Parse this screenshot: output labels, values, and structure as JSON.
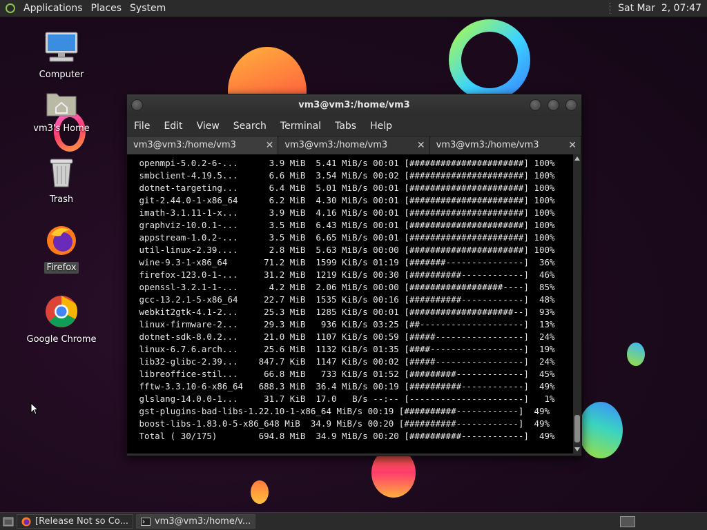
{
  "top_panel": {
    "menus": [
      "Applications",
      "Places",
      "System"
    ],
    "clock": "Sat Mar  2, 07:47"
  },
  "desktop": {
    "icons": [
      {
        "label": "Computer",
        "icon": "computer-icon"
      },
      {
        "label": "vm3's Home",
        "icon": "home-folder-icon"
      },
      {
        "label": "Trash",
        "icon": "trash-icon"
      },
      {
        "label": "Firefox",
        "icon": "firefox-icon",
        "selected": true
      },
      {
        "label": "Google Chrome",
        "icon": "chrome-icon"
      }
    ]
  },
  "terminal": {
    "title": "vm3@vm3:/home/vm3",
    "menu": [
      "File",
      "Edit",
      "View",
      "Search",
      "Terminal",
      "Tabs",
      "Help"
    ],
    "tabs": [
      "vm3@vm3:/home/vm3",
      "vm3@vm3:/home/vm3",
      "vm3@vm3:/home/vm3"
    ],
    "lines": [
      " openmpi-5.0.2-6-...      3.9 MiB  5.41 MiB/s 00:01 [######################] 100%",
      " smbclient-4.19.5...      6.6 MiB  3.54 MiB/s 00:02 [######################] 100%",
      " dotnet-targeting...      6.4 MiB  5.01 MiB/s 00:01 [######################] 100%",
      " git-2.44.0-1-x86_64      6.2 MiB  4.30 MiB/s 00:01 [######################] 100%",
      " imath-3.1.11-1-x...      3.9 MiB  4.16 MiB/s 00:01 [######################] 100%",
      " graphviz-10.0.1-...      3.5 MiB  6.43 MiB/s 00:01 [######################] 100%",
      " appstream-1.0.2-...      3.5 MiB  6.65 MiB/s 00:01 [######################] 100%",
      " util-linux-2.39....      2.8 MiB  5.63 MiB/s 00:00 [######################] 100%",
      " wine-9.3-1-x86_64       71.2 MiB  1599 KiB/s 01:19 [#######---------------]  36%",
      " firefox-123.0-1-...     31.2 MiB  1219 KiB/s 00:30 [##########------------]  46%",
      " openssl-3.2.1-1-...      4.2 MiB  2.06 MiB/s 00:00 [##################----]  85%",
      " gcc-13.2.1-5-x86_64     22.7 MiB  1535 KiB/s 00:16 [##########------------]  48%",
      " webkit2gtk-4.1-2...     25.3 MiB  1285 KiB/s 00:01 [####################--]  93%",
      " linux-firmware-2...     29.3 MiB   936 KiB/s 03:25 [##--------------------]  13%",
      " dotnet-sdk-8.0.2...     21.0 MiB  1107 KiB/s 00:59 [#####-----------------]  24%",
      " linux-6.7.6.arch...     25.6 MiB  1132 KiB/s 01:35 [####------------------]  19%",
      " lib32-glibc-2.39...    847.7 KiB  1147 KiB/s 00:02 [#####-----------------]  24%",
      " libreoffice-stil...     66.8 MiB   733 KiB/s 01:52 [#########-------------]  45%",
      " fftw-3.3.10-6-x86_64   688.3 MiB  36.4 MiB/s 00:19 [##########------------]  49%",
      " glslang-14.0.0-1...     31.7 KiB  17.0   B/s --:-- [----------------------]   1%",
      " gst-plugins-bad-libs-1.22.10-1-x86_64 MiB/s 00:19 [##########------------]  49%",
      " boost-libs-1.83.0-5-x86_648 MiB  34.9 MiB/s 00:20 [##########------------]  49%",
      " Total ( 30/175)        694.8 MiB  34.9 MiB/s 00:20 [##########------------]  49%"
    ]
  },
  "taskbar": {
    "items": [
      {
        "label": "[Release Not so Co...",
        "icon": "firefox-icon"
      },
      {
        "label": "vm3@vm3:/home/v...",
        "icon": "terminal-icon",
        "active": true
      }
    ]
  },
  "colors": {
    "panel_bg": "#2b2b2b",
    "terminal_bg": "#000000",
    "wallpaper": "#1c0a1c"
  }
}
